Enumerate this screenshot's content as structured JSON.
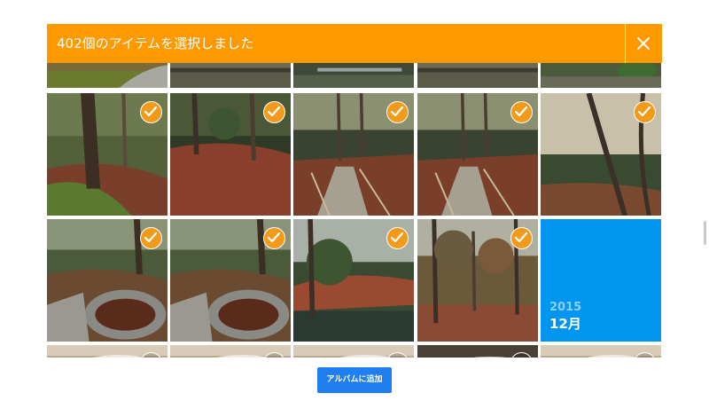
{
  "selection_bar": {
    "title": "402個のアイテムを選択しました",
    "close_icon": "close-icon",
    "background": "#ff9900"
  },
  "photo_grid": {
    "checkmark_color": "#f29a1a",
    "rows": [
      {
        "state": "partial-top",
        "items": [
          {
            "type": "photo",
            "scene": "moss-lawn"
          },
          {
            "type": "photo",
            "scene": "pond"
          },
          {
            "type": "photo",
            "scene": "pond-bridge"
          },
          {
            "type": "photo",
            "scene": "pond"
          },
          {
            "type": "photo",
            "scene": "pond-shrubs"
          }
        ]
      },
      {
        "state": "full",
        "items": [
          {
            "type": "photo",
            "scene": "mossy-tree",
            "selected": true
          },
          {
            "type": "photo",
            "scene": "leaf-floor",
            "selected": true
          },
          {
            "type": "photo",
            "scene": "stone-path",
            "selected": true
          },
          {
            "type": "photo",
            "scene": "stone-path",
            "selected": true
          },
          {
            "type": "photo",
            "scene": "leaning-trees",
            "selected": true
          }
        ]
      },
      {
        "state": "full",
        "items": [
          {
            "type": "photo",
            "scene": "lantern-basin",
            "selected": true
          },
          {
            "type": "photo",
            "scene": "lantern-basin",
            "selected": true
          },
          {
            "type": "photo",
            "scene": "pine-pond",
            "selected": true
          },
          {
            "type": "photo",
            "scene": "autumn-clearing",
            "selected": true
          },
          {
            "type": "date_divider",
            "year": "2015",
            "month": "12月",
            "color": "#0096f0"
          }
        ]
      },
      {
        "state": "partial-bottom",
        "items": [
          {
            "type": "photo",
            "scene": "indoor",
            "selected": false
          },
          {
            "type": "photo",
            "scene": "indoor",
            "selected": false
          },
          {
            "type": "photo",
            "scene": "indoor",
            "selected": false
          },
          {
            "type": "photo",
            "scene": "indoor-dark",
            "selected": false
          },
          {
            "type": "photo",
            "scene": "indoor",
            "selected": false
          }
        ]
      }
    ]
  },
  "footer": {
    "add_to_album_label": "アルバムに追加",
    "button_color": "#1f7ef0"
  }
}
